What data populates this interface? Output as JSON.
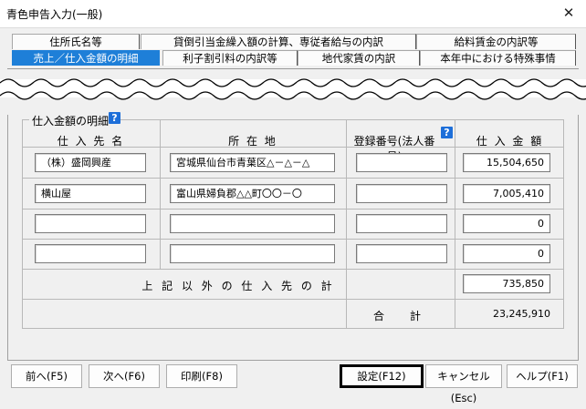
{
  "window": {
    "title": "青色申告入力(一般)",
    "close_glyph": "✕"
  },
  "tabs": {
    "row1": [
      "住所氏名等",
      "貸倒引当金繰入額の計算、専従者給与の内訳",
      "給料賃金の内訳等"
    ],
    "row2": [
      "売上／仕入金額の明細",
      "利子割引料の内訳等",
      "地代家賃の内訳",
      "本年中における特殊事情"
    ],
    "active": "売上／仕入金額の明細"
  },
  "section": {
    "legend": "仕入金額の明細",
    "help_glyph": "?"
  },
  "table": {
    "headers": [
      "仕 入 先 名",
      "所 在 地",
      "登録番号(法人番号)",
      "仕 入 金 額"
    ],
    "rows": [
      {
        "name": "（株）盛岡興産",
        "address": "宮城県仙台市青葉区△－△－△",
        "reg_no": "",
        "amount": "15,504,650"
      },
      {
        "name": "横山屋",
        "address": "富山県婦負郡△△町〇〇－〇",
        "reg_no": "",
        "amount": "7,005,410"
      },
      {
        "name": "",
        "address": "",
        "reg_no": "",
        "amount": "0"
      },
      {
        "name": "",
        "address": "",
        "reg_no": "",
        "amount": "0"
      }
    ],
    "other_label": "上 記 以 外 の 仕 入 先 の 計",
    "other_amount": "735,850",
    "total_label": "合　計",
    "total_amount": "23,245,910"
  },
  "buttons": {
    "prev": "前へ(F5)",
    "next": "次へ(F6)",
    "print": "印刷(F8)",
    "ok": "設定(F12)",
    "cancel": "キャンセル(Esc)",
    "help": "ヘルプ(F1)"
  }
}
